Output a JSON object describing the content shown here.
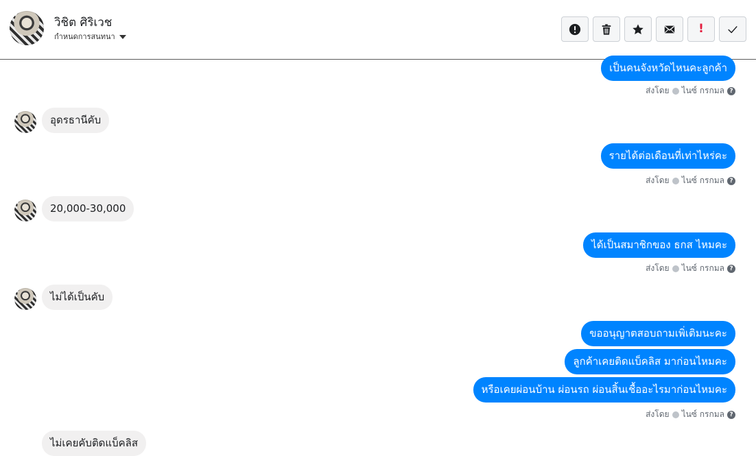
{
  "header": {
    "name": "วิชิต ศิริเวช",
    "subtitle": "กำหนดการสนทนา",
    "actions": [
      {
        "icon": "exclamation-circle-icon"
      },
      {
        "icon": "trash-icon"
      },
      {
        "icon": "star-icon"
      },
      {
        "icon": "envelope-icon"
      },
      {
        "icon": "exclamation-red-icon",
        "text": "!"
      },
      {
        "icon": "checkmark-icon"
      }
    ]
  },
  "meta": {
    "sent_by": "ส่งโดย",
    "sender": "ไนซ์ กรกมล",
    "help": "?"
  },
  "messages": {
    "m1": "เป็นคนจังหวัดไหนคะลูกค้า",
    "m2": "อุดรธานีคับ",
    "m3": "รายได้ต่อเดือนที่เท่าไหร่คะ",
    "m4": "20,000-30,000",
    "m5": "ได้เป็นสมาชิกของ ธกส ไหมคะ",
    "m6": "ไม่ได้เป็นคับ",
    "m7": "ขออนุญาตสอบถามเพิ่เติมนะคะ",
    "m8": "ลูกค้าเคยติดแบ็คลิส มาก่อนไหมคะ",
    "m9": "หรือเคยผ่อนบ้าน ผ่อนรถ ผ่อนสิ้นเชื้ออะไรมาก่อนไหมคะ",
    "m10": "ไม่เคยคับติดแบ็คลิส"
  },
  "colors": {
    "outgoing": "#0084ff",
    "incoming": "#f1f0f0",
    "danger": "#e41e3f"
  }
}
